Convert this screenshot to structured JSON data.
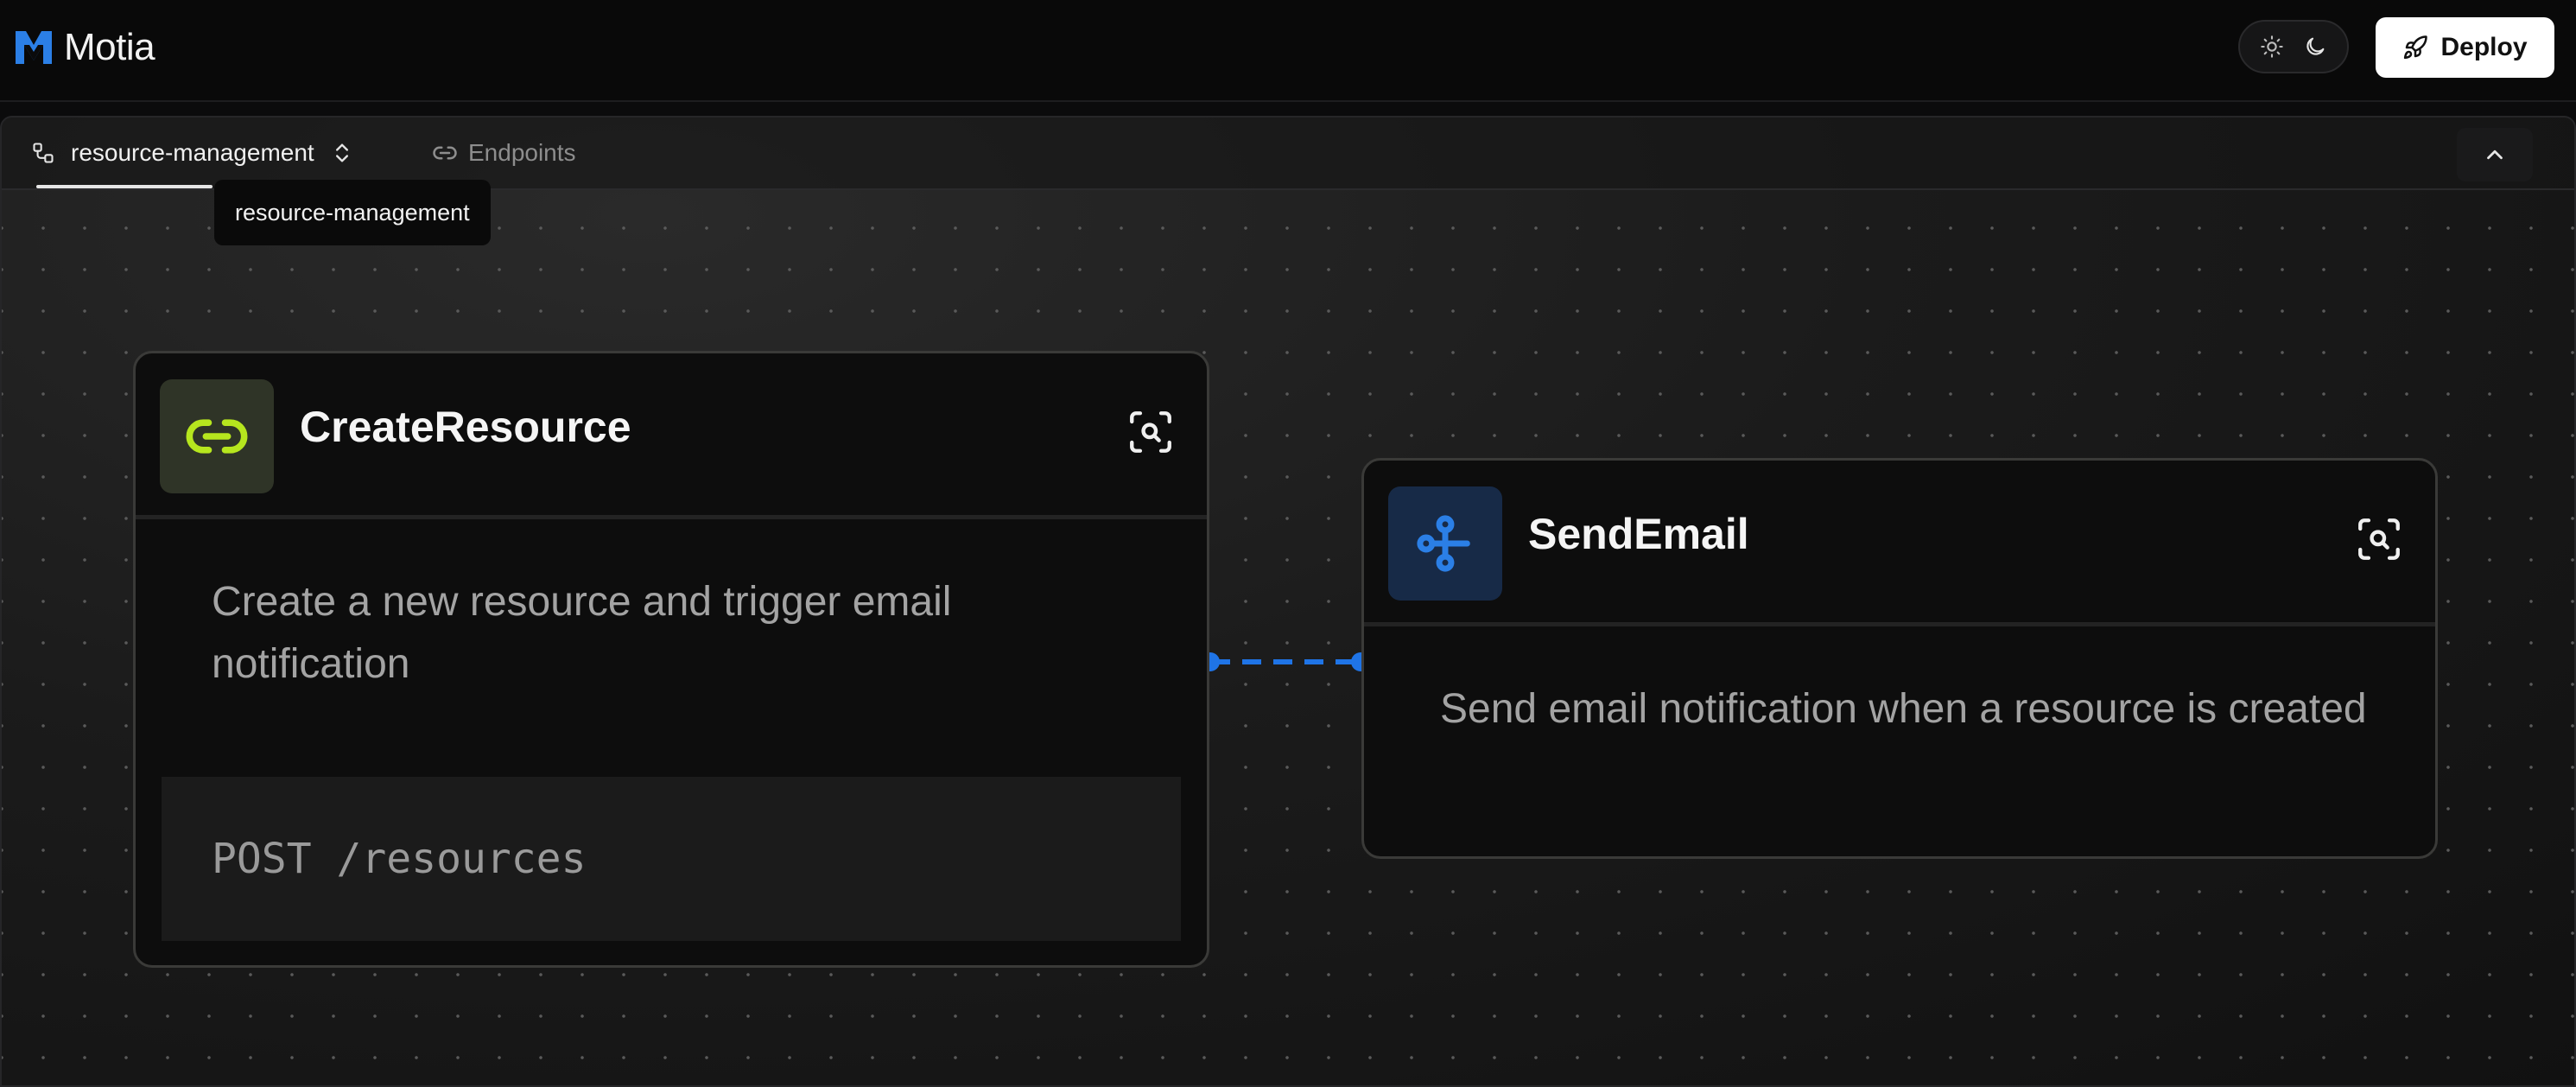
{
  "app": {
    "name": "Motia"
  },
  "header": {
    "theme_light_icon": "sun-icon",
    "theme_dark_icon": "moon-icon",
    "deploy_label": "Deploy"
  },
  "tabs": {
    "flow_label": "resource-management",
    "endpoints_label": "Endpoints",
    "tooltip": "resource-management"
  },
  "nodes": {
    "create_resource": {
      "title": "CreateResource",
      "description": "Create a new resource and trigger email notification",
      "method_route": "POST /resources",
      "icon": "link-icon",
      "accent": "#b6e61e"
    },
    "send_email": {
      "title": "SendEmail",
      "description": "Send email notification when a resource is created",
      "icon": "event-icon",
      "accent": "#2b7fe6"
    }
  },
  "edge": {
    "color": "#1f74e6"
  }
}
